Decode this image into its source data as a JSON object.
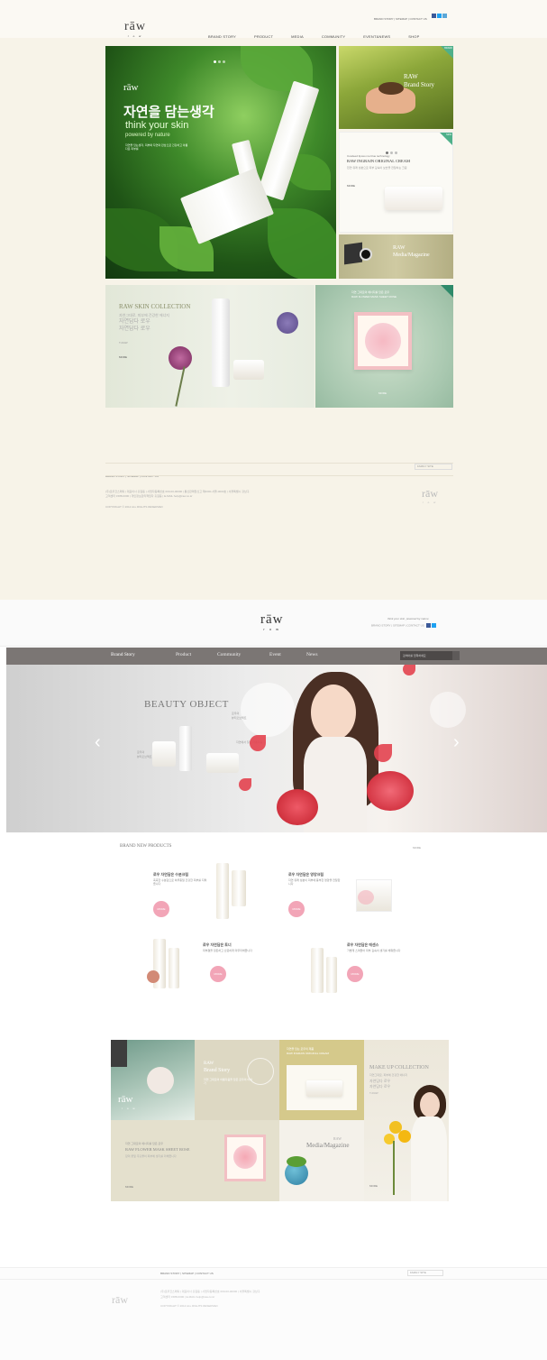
{
  "designA": {
    "logo": {
      "mark": "rāw",
      "sub": "r o w"
    },
    "util_links": "BRAND STORY  |  SITEMAP  |  CONTACT US",
    "nav": [
      "BRAND STORY",
      "PRODUCT",
      "MEDIA",
      "COMMUNITY",
      "EVENT&NEWS",
      "SHOP"
    ],
    "hero": {
      "logo": "rāw",
      "headline": "자연을 담는생각",
      "think": "think your skin",
      "powered": "powered by nature",
      "desc": "자연을 담는생각, 피부와 자연의 만남으로 건강하고 아름다운 피부를"
    },
    "story_panel": {
      "title1": "RAW",
      "title2": "Brand Story",
      "badge": "BRAND"
    },
    "cream_panel": {
      "kicker": "Cosdeed liposo me blue technology",
      "title": "RAW INGRAIN ORIGINAL CREAM",
      "desc": "천연 유래 성분으로 피부 깊숙이 보습을 전달하는 크림",
      "more": "MORE",
      "badge": "NEW"
    },
    "mag_panel": {
      "title1": "RAW",
      "title2": "Media/Magazine"
    },
    "skin_collection": {
      "title": "RAW SKIN COLLECTION",
      "line1": "자연그대로, 피부에 건강한 에너지",
      "line2": "자연담다 로우",
      "line3": "자연담다 로우",
      "label": "T-RAW",
      "more": "MORE"
    },
    "mask_panel": {
      "kicker": "자연 그대로의 에너지를 담은 로우",
      "title": "RAW FLOWER MASK SHEET ROSE",
      "more": "MORE"
    },
    "footer": {
      "links": "BRAND STORY  |  SITEMAP  |  CONTACT US",
      "select": "FAMILY SITE",
      "copy1": "(주)로우코스메틱  |  대표이사 홍길동  |  사업자등록번호 000-00-00000  |  통신판매업신고 제0000-서울-0000호  |  서울특별시 강남구",
      "copy2": "고객센터 1588-0000  |  개인정보관리책임자 홍길동  |  E-MAIL help@raw.co.kr",
      "copyright": "COPYRIGHT © 2012 ALL RIGHTS RESERVED",
      "logo": "rāw",
      "logo_sub": "r o w"
    }
  },
  "designB": {
    "logo": {
      "mark": "rāw",
      "sub": "r o w"
    },
    "tagline": "think your skin, powered by nature",
    "util_links": "BRAND STORY  |  SITEMAP  |  CONTACT US",
    "nav": [
      "Brand Story",
      "Product",
      "Community",
      "Event",
      "News"
    ],
    "search_placeholder": "검색어를 입력하세요",
    "hero": {
      "title": "BEAUTY OBJECT",
      "sub1": "로우의",
      "sub2": "뷰티오브젝트",
      "tag1": "로우의",
      "tag2": "뷰티오브젝트",
      "tag3": "자연에서 찾은 아름다움",
      "prev": "‹",
      "next": "›"
    },
    "products": {
      "heading": "BRAND NEW PRODUCTS",
      "more": "MORE",
      "items": [
        {
          "name": "로우 자연담은 수분크림",
          "desc": "촉촉한 수분감으로 하루종일 건강한 피부를 지켜줍니다",
          "button": "MORE"
        },
        {
          "name": "로우 자연담은 영양크림",
          "desc": "자연 유래 성분이 피부에 풍부한 영양을 전달합니다",
          "button": "MORE"
        },
        {
          "name": "로우 자연담은 토너",
          "desc": "피부결을 정돈하고 산뜻하게 마무리해줍니다",
          "button": "MORE"
        },
        {
          "name": "로우 자연담은 에센스",
          "desc": "가볍게 스며들어 피부 깊숙이 생기를 채워줍니다",
          "button": "MORE"
        }
      ]
    },
    "grid": {
      "story": {
        "title1": "RAW",
        "title2": "Brand Story",
        "desc": "자연 그대로의 아름다움을 담은 로우의 이야기"
      },
      "cream": {
        "kicker": "자연을 담는 로우의 제품",
        "title": "RAW INGRAIN ORIGINAL CREAM"
      },
      "makeup": {
        "title": "MAKE UP COLLECTION",
        "line1": "자연그대로, 피부에 건강한 에너지",
        "line2": "자연담다 로우",
        "line3": "자연담다 로우",
        "label": "T-RAW",
        "more": "MORE"
      },
      "mask": {
        "kicker": "자연 그대로의 에너지를 담은 로우",
        "title": "RAW FLOWER MASK SHEET ROSE",
        "desc": "장미 꽃잎 추출물이 피부에 생기를 더해줍니다",
        "more": "MORE"
      },
      "media": {
        "title1": "RAW",
        "title2": "Media/Magazine"
      },
      "logo": "rāw",
      "logo_sub": "r o w"
    },
    "footer": {
      "links": "BRAND STORY  |  SITEMAP  |  CONTACT US",
      "select": "FAMILY SITE",
      "copy1": "(주)로우코스메틱  |  대표이사 홍길동  |  사업자등록번호 000-00-00000  |  서울특별시 강남구",
      "copy2": "고객센터 1588-0000  |  E-MAIL help@raw.co.kr",
      "copyright": "COPYRIGHT © 2012 ALL RIGHTS RESERVED",
      "logo": "rāw"
    }
  },
  "colors": {
    "accent_green": "#4fb08a",
    "nav_gray": "#7b7674",
    "pink_button": "#f2a5b7",
    "petal_red": "#e3424f"
  }
}
